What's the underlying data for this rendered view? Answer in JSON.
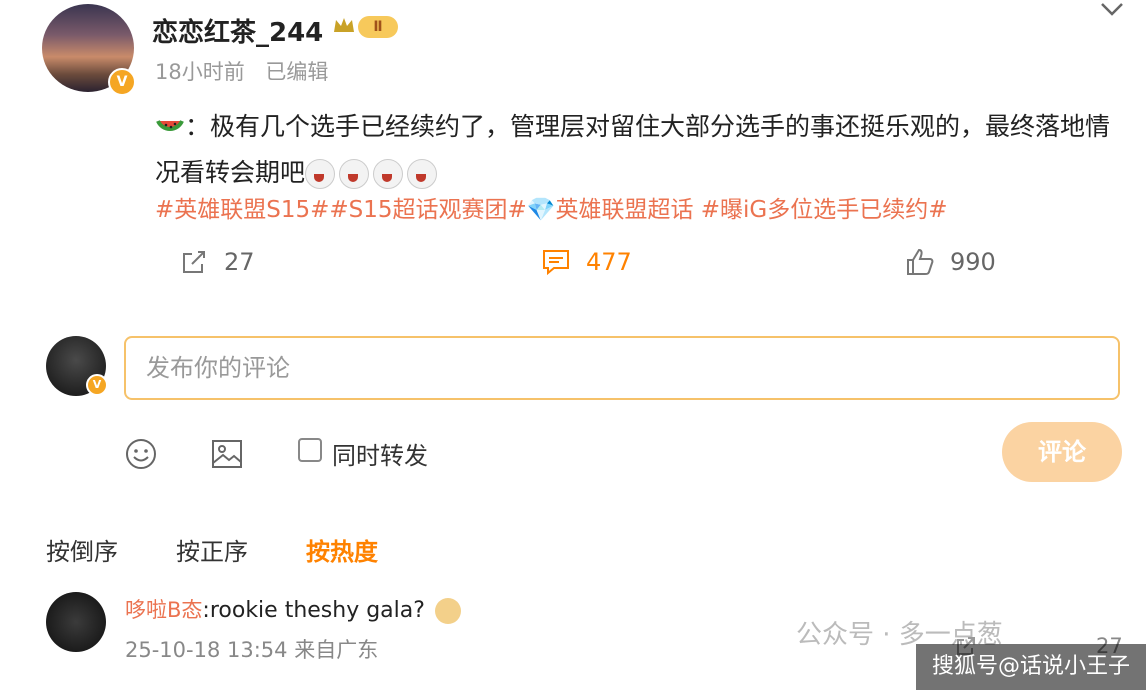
{
  "post": {
    "username": "恋恋红茶_244",
    "level_badge": "Ⅱ",
    "time": "18小时前",
    "edited": "已编辑",
    "body_prefix": "：极有几个选手已经续约了，管理层对留住大部分选手的事还挺乐观的，最终落地情况看转会期吧",
    "tags": "#英雄联盟S15##S15超话观赛团#💎英雄联盟超话 #曝iG多位选手已续约#",
    "repost_count": "27",
    "comment_count": "477",
    "like_count": "990"
  },
  "composer": {
    "placeholder": "发布你的评论",
    "repost_label": "同时转发",
    "submit_label": "评论"
  },
  "sort": {
    "reverse": "按倒序",
    "forward": "按正序",
    "hot": "按热度"
  },
  "comment": {
    "name": "哆啦B态",
    "text": ":rookie theshy gala?",
    "meta": "25-10-18 13:54 来自广东",
    "action_count": "27"
  },
  "watermark": "公众号 · 多一点葱",
  "sohu": "搜狐号@话说小王子",
  "colors": {
    "accent": "#ff8200",
    "tag": "#eb7350"
  }
}
